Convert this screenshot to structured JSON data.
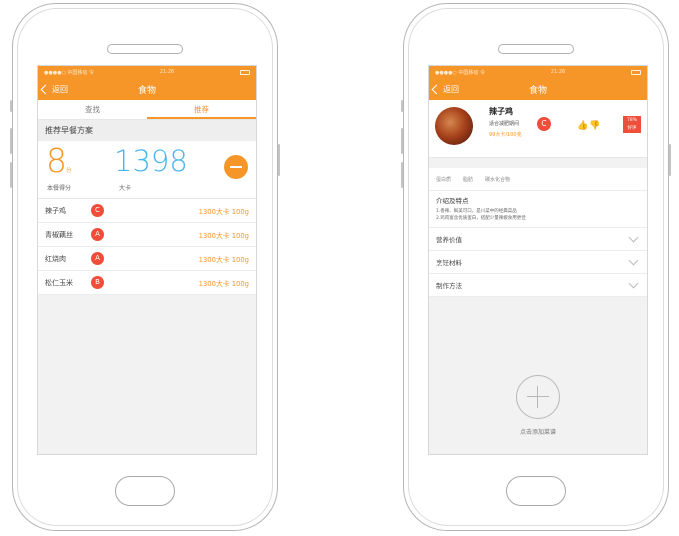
{
  "colors": {
    "accent": "#f79628",
    "kcal_blue": "#49b5ee",
    "grade_red": "#ee4e3a"
  },
  "left": {
    "status": {
      "carrier": "●●●●○ 中国移动 令",
      "time": "21:26"
    },
    "nav": {
      "back_label": "返回",
      "title": "食物"
    },
    "tabs": [
      {
        "label": "查找",
        "active": false
      },
      {
        "label": "推荐",
        "active": true
      }
    ],
    "section_title": "推荐早餐方案",
    "score": {
      "value": "8",
      "unit": "分",
      "label": "本餐得分"
    },
    "kcal": {
      "value": "1398",
      "unit": "大卡"
    },
    "refresh_icon": "refresh-minus-icon",
    "foods": [
      {
        "name": "辣子鸡",
        "grade": "C",
        "value": "1300大卡 100g"
      },
      {
        "name": "青椒藕丝",
        "grade": "A",
        "value": "1300大卡 100g"
      },
      {
        "name": "红烧肉",
        "grade": "A",
        "value": "1300大卡 100g"
      },
      {
        "name": "松仁玉米",
        "grade": "B",
        "value": "1300大卡 100g"
      }
    ]
  },
  "right": {
    "status": {
      "carrier": "●●●●○ 中国移动 令",
      "time": "21:26"
    },
    "nav": {
      "back_label": "返回",
      "title": "食物"
    },
    "dish": {
      "name": "辣子鸡",
      "desc": "适合减肥期间",
      "cal": "99大卡/100克",
      "grade": "C",
      "ratio": "78%",
      "ratio_label": "好评"
    },
    "meta": [
      "蛋白质",
      "脂肪",
      "碳水化合物"
    ],
    "intro": {
      "title": "介绍及特点",
      "lines": [
        "1.香辣、鲜美可口，是川菜中的经典菜品",
        "2.鸡肉富含优质蛋白，搭配少量辣椒食用更佳"
      ]
    },
    "sections": [
      "营养价值",
      "烹饪材料",
      "制作方法"
    ],
    "add_label": "点击添加菜谱"
  }
}
